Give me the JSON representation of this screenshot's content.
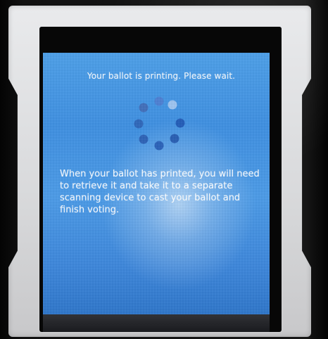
{
  "screen": {
    "status_message": "Your ballot is printing. Please wait.",
    "instructions": "When your ballot has printed, you will need to retrieve it and take it to a separate scanning device to cast your ballot and finish voting."
  },
  "spinner": {
    "icon": "loading-spinner-icon",
    "dot_colors": [
      "#4d80d2",
      "#9cc3ef",
      "#245db8",
      "#2a5fb3",
      "#2c63b9",
      "#2e63b6",
      "#3068ba",
      "#416fba"
    ]
  }
}
